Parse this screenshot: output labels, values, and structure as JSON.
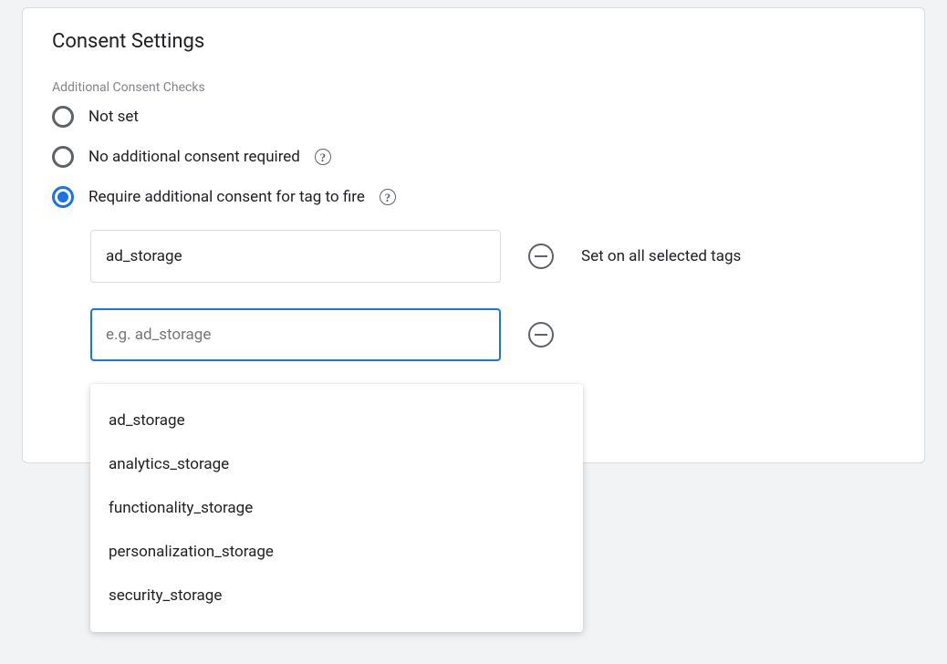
{
  "card": {
    "title": "Consent Settings",
    "section_label": "Additional Consent Checks"
  },
  "radio_options": {
    "not_set": "Not set",
    "no_additional": "No additional consent required",
    "require_additional": "Require additional consent for tag to fire"
  },
  "consent_rows": [
    {
      "value": "ad_storage",
      "placeholder": "",
      "note": "Set on all selected tags",
      "focused": false
    },
    {
      "value": "",
      "placeholder": "e.g. ad_storage",
      "note": "",
      "focused": true
    }
  ],
  "dropdown_items": [
    "ad_storage",
    "analytics_storage",
    "functionality_storage",
    "personalization_storage",
    "security_storage"
  ],
  "selected_radio": "require_additional"
}
